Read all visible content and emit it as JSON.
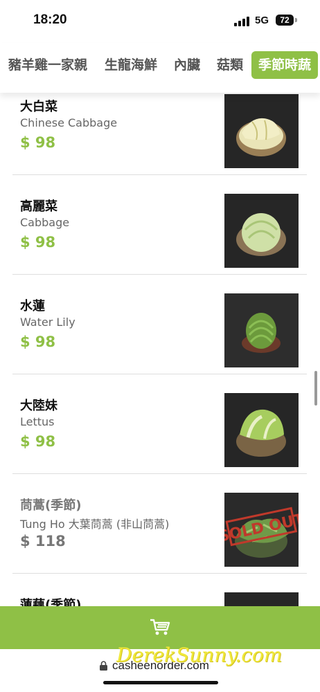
{
  "status_bar": {
    "time": "18:20",
    "network": "5G",
    "battery": "72"
  },
  "categories": [
    {
      "label": "豬羊雞一家親",
      "active": false
    },
    {
      "label": "生龍海鮮",
      "active": false
    },
    {
      "label": "內臟",
      "active": false
    },
    {
      "label": "菇類",
      "active": false
    },
    {
      "label": "季節時蔬",
      "active": true
    }
  ],
  "accent_color": "#8fc046",
  "menu_items": [
    {
      "name": "大白菜",
      "english": "Chinese Cabbage",
      "price": "$ 98",
      "photo": "chinese-cabbage",
      "sold_out": false
    },
    {
      "name": "高麗菜",
      "english": "Cabbage",
      "price": "$ 98",
      "photo": "cabbage",
      "sold_out": false
    },
    {
      "name": "水蓮",
      "english": "Water Lily",
      "price": "$ 98",
      "photo": "water-lily",
      "sold_out": false
    },
    {
      "name": "大陸妹",
      "english": "Lettus",
      "price": "$ 98",
      "photo": "lettuce",
      "sold_out": false
    },
    {
      "name": "茼蒿(季節)",
      "english": "Tung Ho 大葉茼蒿 (非山茼蒿)",
      "price": "$ 118",
      "photo": "tung-ho",
      "sold_out": true,
      "stamp": "SOLD OUT"
    },
    {
      "name": "蓮藕(季節)",
      "english": "",
      "price": "",
      "photo": "lotus-root",
      "sold_out": false
    }
  ],
  "cart": {
    "icon": "cart-icon"
  },
  "url_bar": {
    "url": "casheenorder.com"
  },
  "watermark": "DerekSunny.com"
}
